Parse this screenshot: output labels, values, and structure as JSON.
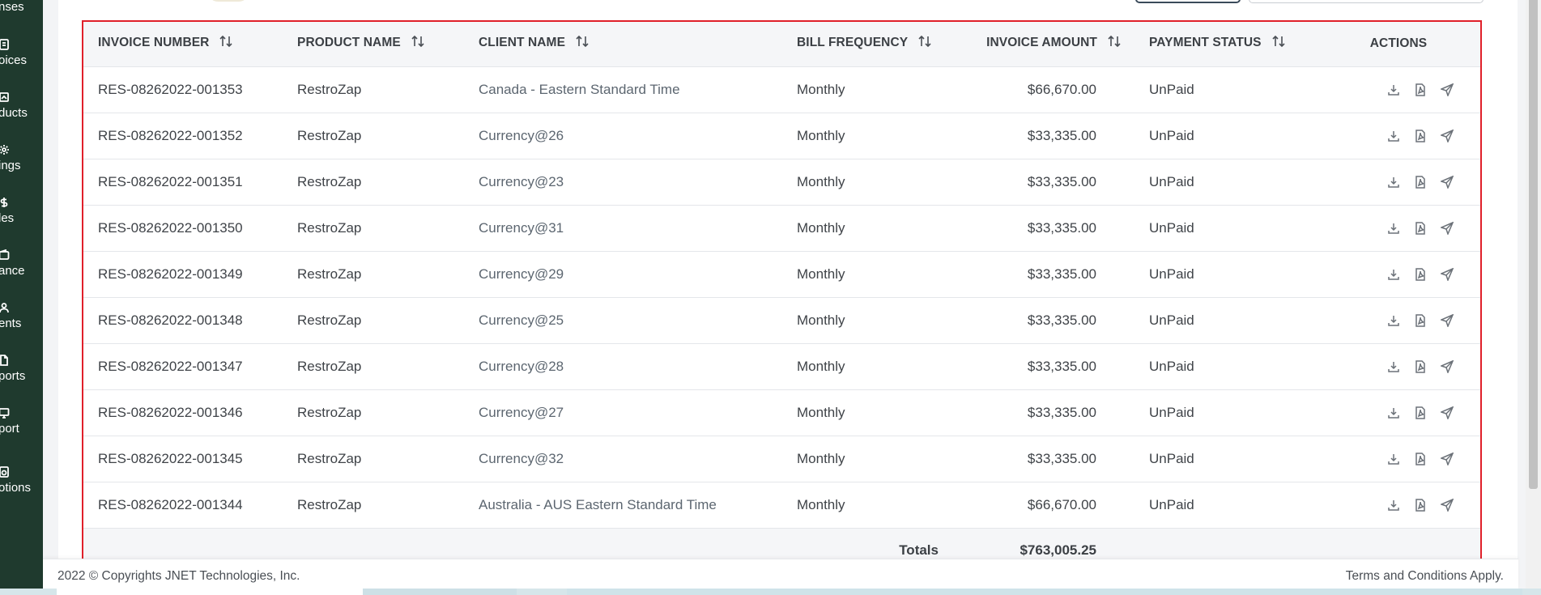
{
  "sidebar": {
    "items": [
      {
        "label": "nses",
        "icon": "expense-icon"
      },
      {
        "label": "oices",
        "icon": "invoice-icon"
      },
      {
        "label": "ducts",
        "icon": "products-icon"
      },
      {
        "label": "ings",
        "icon": "settings-icon"
      },
      {
        "label": "les",
        "icon": "dollar-icon"
      },
      {
        "label": "ance",
        "icon": "wallet-icon"
      },
      {
        "label": "ents",
        "icon": "user-icon"
      },
      {
        "label": "ports",
        "icon": "file-icon"
      },
      {
        "label": "port",
        "icon": "monitor-icon"
      },
      {
        "label": "otions",
        "icon": "promotion-icon"
      }
    ]
  },
  "table": {
    "headers": {
      "invoice_number": "INVOICE NUMBER",
      "product_name": "PRODUCT NAME",
      "client_name": "CLIENT NAME",
      "bill_frequency": "BILL FREQUENCY",
      "invoice_amount": "INVOICE AMOUNT",
      "payment_status": "PAYMENT STATUS",
      "actions": "ACTIONS"
    },
    "rows": [
      {
        "invoice": "RES-08262022-001353",
        "product": "RestroZap",
        "client": "Canada - Eastern Standard Time",
        "frequency": "Monthly",
        "amount": "$66,670.00",
        "status": "UnPaid"
      },
      {
        "invoice": "RES-08262022-001352",
        "product": "RestroZap",
        "client": "Currency@26",
        "frequency": "Monthly",
        "amount": "$33,335.00",
        "status": "UnPaid"
      },
      {
        "invoice": "RES-08262022-001351",
        "product": "RestroZap",
        "client": "Currency@23",
        "frequency": "Monthly",
        "amount": "$33,335.00",
        "status": "UnPaid"
      },
      {
        "invoice": "RES-08262022-001350",
        "product": "RestroZap",
        "client": "Currency@31",
        "frequency": "Monthly",
        "amount": "$33,335.00",
        "status": "UnPaid"
      },
      {
        "invoice": "RES-08262022-001349",
        "product": "RestroZap",
        "client": "Currency@29",
        "frequency": "Monthly",
        "amount": "$33,335.00",
        "status": "UnPaid"
      },
      {
        "invoice": "RES-08262022-001348",
        "product": "RestroZap",
        "client": "Currency@25",
        "frequency": "Monthly",
        "amount": "$33,335.00",
        "status": "UnPaid"
      },
      {
        "invoice": "RES-08262022-001347",
        "product": "RestroZap",
        "client": "Currency@28",
        "frequency": "Monthly",
        "amount": "$33,335.00",
        "status": "UnPaid"
      },
      {
        "invoice": "RES-08262022-001346",
        "product": "RestroZap",
        "client": "Currency@27",
        "frequency": "Monthly",
        "amount": "$33,335.00",
        "status": "UnPaid"
      },
      {
        "invoice": "RES-08262022-001345",
        "product": "RestroZap",
        "client": "Currency@32",
        "frequency": "Monthly",
        "amount": "$33,335.00",
        "status": "UnPaid"
      },
      {
        "invoice": "RES-08262022-001344",
        "product": "RestroZap",
        "client": "Australia - AUS Eastern Standard Time",
        "frequency": "Monthly",
        "amount": "$66,670.00",
        "status": "UnPaid"
      }
    ],
    "action_icons": [
      "download-icon",
      "pdf-icon",
      "send-icon"
    ],
    "totals": {
      "label": "Totals",
      "value": "$763,005.25"
    }
  },
  "footer": {
    "copyright": "2022 © Copyrights JNET Technologies, Inc.",
    "terms": "Terms and Conditions Apply."
  },
  "colors": {
    "sidebar_bg": "#1f3a2e",
    "header_bg": "#f5f6f8",
    "highlight_outline": "#e0202a"
  }
}
